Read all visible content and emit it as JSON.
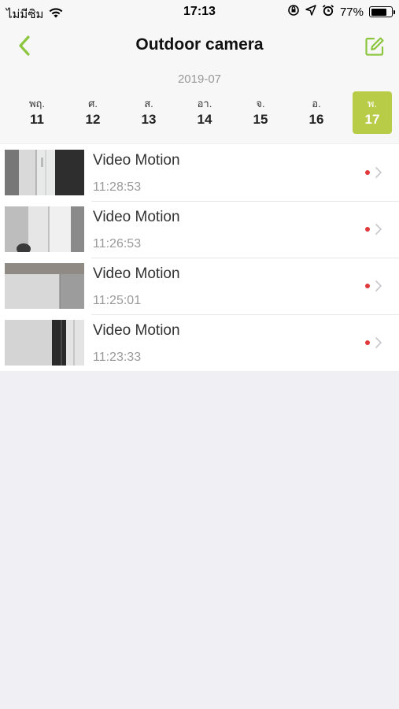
{
  "status_bar": {
    "carrier": "ไม่มีซิม",
    "time": "17:13",
    "battery": "77%",
    "battery_level": 0.77
  },
  "nav": {
    "title": "Outdoor camera",
    "back_icon": "chevron-left-icon",
    "edit_icon": "edit-icon",
    "accent_color": "#8cc63f"
  },
  "calendar": {
    "month": "2019-07",
    "selected_color": "#b8cc47",
    "days": [
      {
        "name": "พฤ.",
        "num": "11"
      },
      {
        "name": "ศ.",
        "num": "12"
      },
      {
        "name": "ส.",
        "num": "13"
      },
      {
        "name": "อา.",
        "num": "14"
      },
      {
        "name": "จ.",
        "num": "15"
      },
      {
        "name": "อ.",
        "num": "16"
      },
      {
        "name": "พ.",
        "num": "17"
      }
    ]
  },
  "events": [
    {
      "title": "Video Motion",
      "time": "11:28:53"
    },
    {
      "title": "Video Motion",
      "time": "11:26:53"
    },
    {
      "title": "Video Motion",
      "time": "11:25:01"
    },
    {
      "title": "Video Motion",
      "time": "11:23:33"
    }
  ]
}
